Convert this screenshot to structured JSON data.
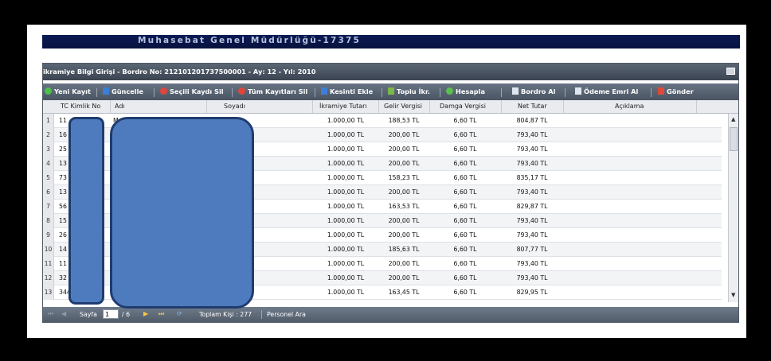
{
  "app_title": "Muhasebat Genel Müdürlüğü-17375",
  "panel_title": "ikramiye Bilgi Girişi - Bordro No: 212101201737500001 - Ay: 12 - Yıl: 2010",
  "toolbar": {
    "new_record": "Yeni Kayıt",
    "update": "Güncelle",
    "delete_selected": "Seçili Kaydı Sil",
    "delete_all": "Tüm Kayıtları Sil",
    "add_deduction": "Kesinti Ekle",
    "bulk_bonus": "Toplu İkr.",
    "calculate": "Hesapla",
    "get_payroll": "Bordro Al",
    "get_payment_order": "Ödeme Emri Al",
    "send": "Gönder"
  },
  "columns": {
    "tc": "TC Kimlik No",
    "name": "Adı",
    "surname": "Soyadı",
    "bonus": "İkramiye Tutarı",
    "income_tax": "Gelir Vergisi",
    "stamp_tax": "Damga Vergisi",
    "net": "Net Tutar",
    "note": "Açıklama"
  },
  "rows": [
    {
      "n": "1",
      "tc": "11",
      "name": "M",
      "bonus": "1.000,00 TL",
      "income_tax": "188,53 TL",
      "stamp_tax": "6,60 TL",
      "net": "804,87 TL"
    },
    {
      "n": "2",
      "tc": "16",
      "name": "",
      "bonus": "1.000,00 TL",
      "income_tax": "200,00 TL",
      "stamp_tax": "6,60 TL",
      "net": "793,40 TL"
    },
    {
      "n": "3",
      "tc": "25",
      "name": "",
      "bonus": "1.000,00 TL",
      "income_tax": "200,00 TL",
      "stamp_tax": "6,60 TL",
      "net": "793,40 TL"
    },
    {
      "n": "4",
      "tc": "13",
      "name": "",
      "bonus": "1.000,00 TL",
      "income_tax": "200,00 TL",
      "stamp_tax": "6,60 TL",
      "net": "793,40 TL"
    },
    {
      "n": "5",
      "tc": "73",
      "name": "",
      "bonus": "1.000,00 TL",
      "income_tax": "158,23 TL",
      "stamp_tax": "6,60 TL",
      "net": "835,17 TL"
    },
    {
      "n": "6",
      "tc": "13",
      "name": "",
      "bonus": "1.000,00 TL",
      "income_tax": "200,00 TL",
      "stamp_tax": "6,60 TL",
      "net": "793,40 TL"
    },
    {
      "n": "7",
      "tc": "56",
      "name": "",
      "bonus": "1.000,00 TL",
      "income_tax": "163,53 TL",
      "stamp_tax": "6,60 TL",
      "net": "829,87 TL"
    },
    {
      "n": "8",
      "tc": "15",
      "name": "",
      "bonus": "1.000,00 TL",
      "income_tax": "200,00 TL",
      "stamp_tax": "6,60 TL",
      "net": "793,40 TL"
    },
    {
      "n": "9",
      "tc": "26",
      "name": "",
      "bonus": "1.000,00 TL",
      "income_tax": "200,00 TL",
      "stamp_tax": "6,60 TL",
      "net": "793,40 TL"
    },
    {
      "n": "10",
      "tc": "14",
      "name": "",
      "bonus": "1.000,00 TL",
      "income_tax": "185,63 TL",
      "stamp_tax": "6,60 TL",
      "net": "807,77 TL"
    },
    {
      "n": "11",
      "tc": "11",
      "name": "",
      "bonus": "1.000,00 TL",
      "income_tax": "200,00 TL",
      "stamp_tax": "6,60 TL",
      "net": "793,40 TL"
    },
    {
      "n": "12",
      "tc": "32",
      "name": "",
      "bonus": "1.000,00 TL",
      "income_tax": "200,00 TL",
      "stamp_tax": "6,60 TL",
      "net": "793,40 TL"
    },
    {
      "n": "13",
      "tc": "344",
      "name": "M",
      "bonus": "1.000,00 TL",
      "income_tax": "163,45 TL",
      "stamp_tax": "6,60 TL",
      "net": "829,95 TL"
    }
  ],
  "footer": {
    "page_label": "Sayfa",
    "page_value": "1",
    "page_total": "/ 6",
    "total_label": "Toplam Kişi : 277",
    "search_label": "Personel Ara"
  },
  "icons": {
    "new": "plus-circle-icon",
    "update": "save-icon",
    "delete": "minus-circle-icon",
    "deduction": "save-icon",
    "bulk": "person-icon",
    "calc": "calculator-icon",
    "payroll": "document-icon",
    "send": "send-icon"
  },
  "colors": {
    "title_bg": "#0a1a55",
    "toolbar_bg": "#5a6575",
    "redaction": "#4e7bbd"
  }
}
